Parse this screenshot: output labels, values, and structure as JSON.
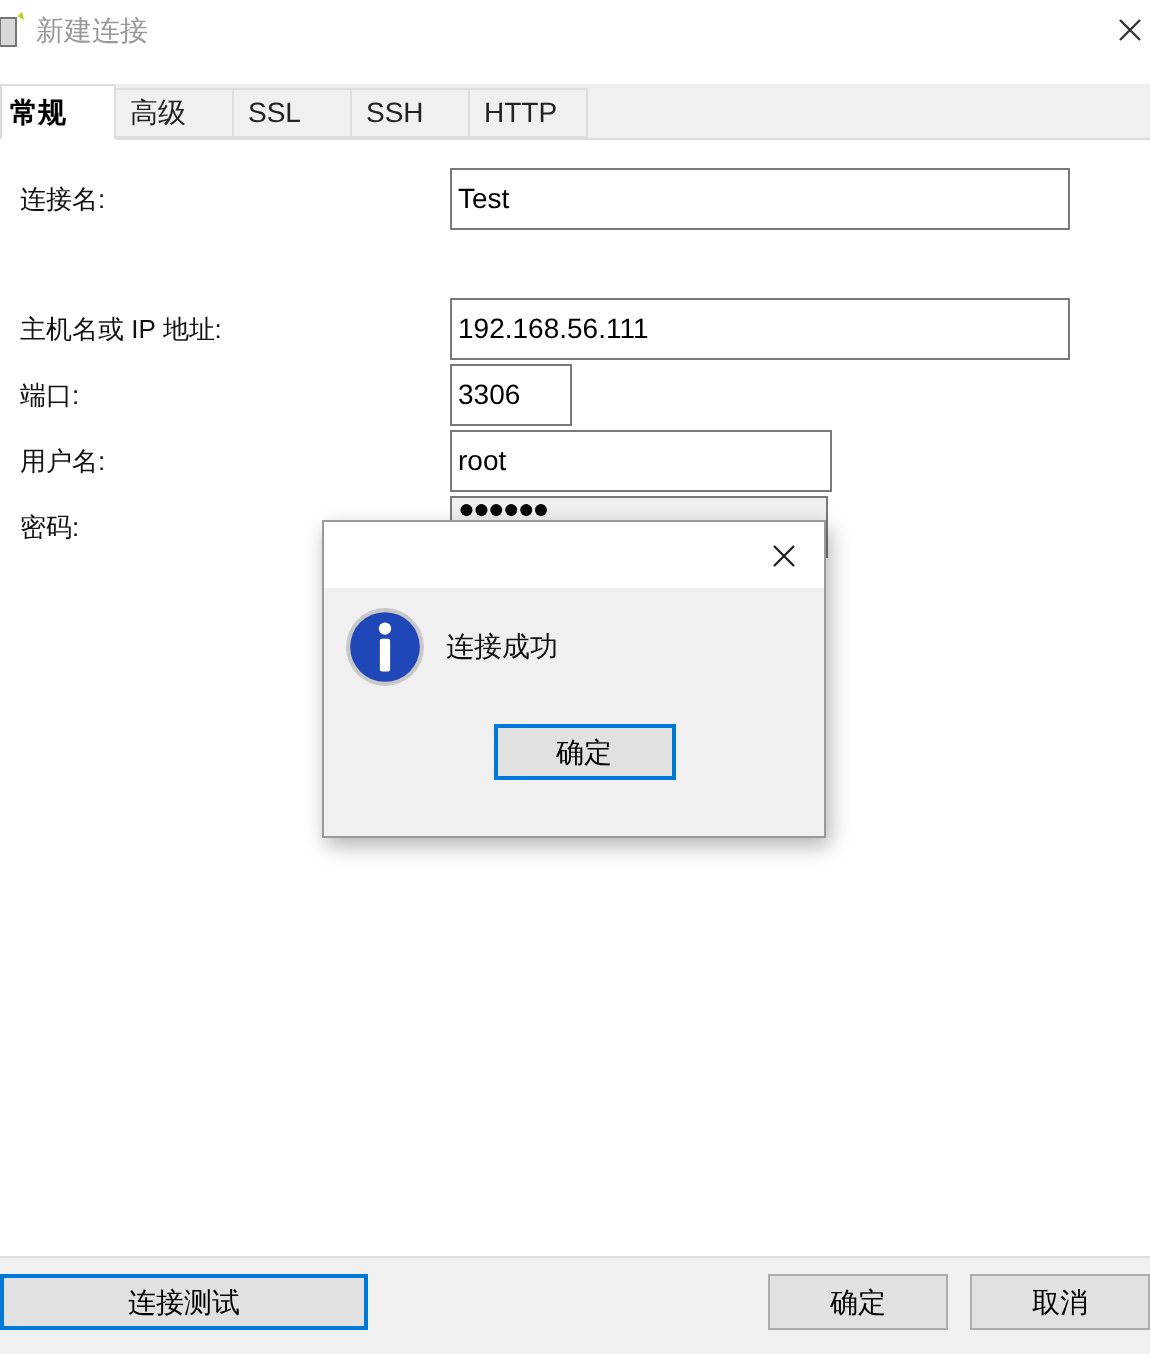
{
  "window": {
    "title": "新建连接"
  },
  "tabs": [
    {
      "label": "常规",
      "selected": true
    },
    {
      "label": "高级",
      "selected": false
    },
    {
      "label": "SSL",
      "selected": false
    },
    {
      "label": "SSH",
      "selected": false
    },
    {
      "label": "HTTP",
      "selected": false
    }
  ],
  "fields": [
    {
      "label": "连接名:",
      "value": "Test",
      "kind": "wide"
    },
    {
      "label": "主机名或 IP 地址:",
      "value": "192.168.56.111",
      "kind": "wide"
    },
    {
      "label": "端口:",
      "value": "3306",
      "kind": "short"
    },
    {
      "label": "用户名:",
      "value": "root",
      "kind": "medium"
    },
    {
      "label": "密码:",
      "value": "●●●●●●",
      "kind": "password"
    }
  ],
  "dialog": {
    "message": "连接成功",
    "button": "确定"
  },
  "buttons": {
    "test": "连接测试",
    "ok": "确定",
    "cancel": "取消"
  }
}
